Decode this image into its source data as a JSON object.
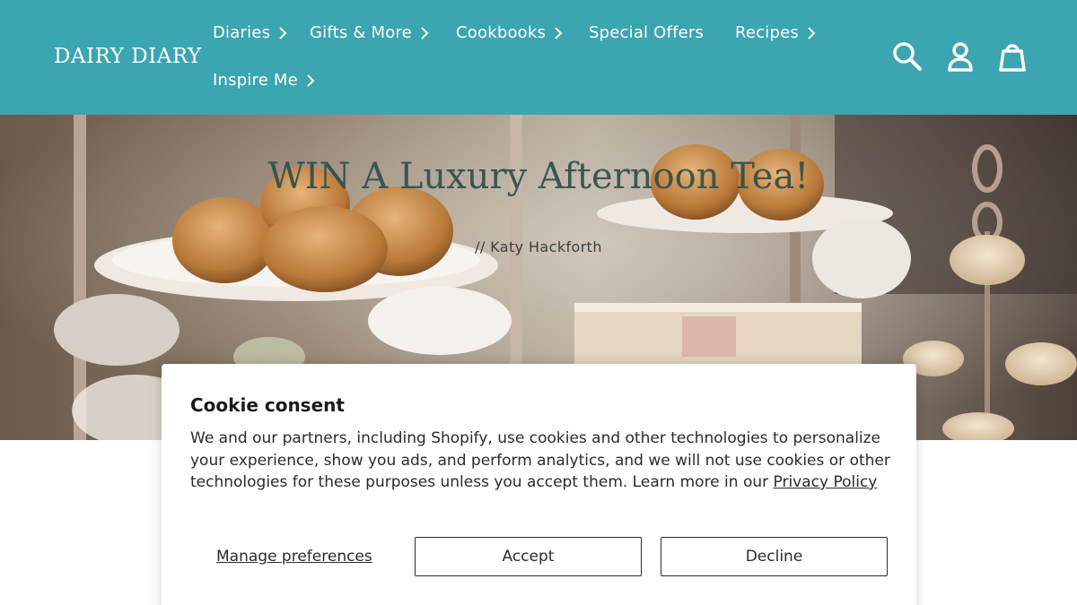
{
  "header": {
    "logo": "DAIRY DIARY",
    "nav": [
      {
        "label": "Diaries"
      },
      {
        "label": "Gifts & More"
      },
      {
        "label": "Cookbooks"
      },
      {
        "label": "Special Offers"
      },
      {
        "label": "Recipes"
      },
      {
        "label": "Inspire Me"
      }
    ],
    "icons": [
      "search-icon",
      "account-icon",
      "cart-icon"
    ],
    "color": "#3ba5b1"
  },
  "hero": {
    "title": "WIN A Luxury Afternoon Tea!",
    "author": "//  Katy Hackforth"
  },
  "cookie": {
    "title": "Cookie consent",
    "body": "We and our partners, including Shopify, use cookies and other technologies to personalize your experience, show you ads, and perform analytics, and we will not use cookies or other technologies for these purposes unless you accept them. Learn more in our ",
    "privacy_link": "Privacy Policy",
    "manage": "Manage preferences",
    "accept": "Accept",
    "decline": "Decline"
  }
}
